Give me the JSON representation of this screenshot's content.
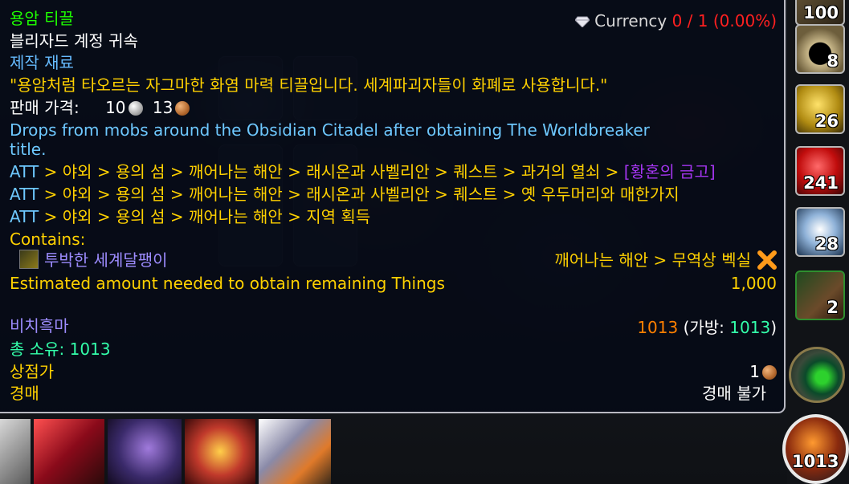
{
  "item": {
    "name": "용암 티끌",
    "binding": "블리자드 계정 귀속",
    "category": "제작 재료",
    "flavor": "\"용암처럼 타오르는 자그마한 화염 마력 티끌입니다. 세계파괴자들이 화폐로 사용합니다.\"",
    "sell_label": "판매 가격:",
    "sell_silver": "10",
    "sell_copper": "13"
  },
  "currency": {
    "label": "Currency",
    "progress": "0 / 1 (0.00%)",
    "progress_fraction": 0
  },
  "source": {
    "description_line1": "Drops from mobs around the Obsidian Citadel after obtaining The Worldbreaker",
    "description_line2": "title."
  },
  "paths": [
    {
      "prefix": "ATT",
      "path": " > 야외 > 용의 섬 > 깨어나는 해안 > 래시온과 사벨리안 > 퀘스트 > 과거의 열쇠 > ",
      "highlight": "[황혼의 금고]"
    },
    {
      "prefix": "ATT",
      "path": " > 야외 > 용의 섬 > 깨어나는 해안 > 래시온과 사벨리안 > 퀘스트 > 옛 우두머리와 매한가지",
      "highlight": ""
    },
    {
      "prefix": "ATT",
      "path": " > 야외 > 용의 섬 > 깨어나는 해안 > 지역 획득",
      "highlight": ""
    }
  ],
  "contains": {
    "label": "Contains:",
    "item_name": "투박한 세계달팽이",
    "item_location": "깨어나는 해안 > 무역상 벡실"
  },
  "estimate": {
    "label": "Estimated amount needed to obtain remaining Things",
    "value": "1,000"
  },
  "owners": {
    "character": "비치흑마",
    "count": "1013",
    "bag_label": "(가방: ",
    "bag_count": "1013",
    "bag_close": ")",
    "total_label": "총 소유: ",
    "total": "1013"
  },
  "vendor": {
    "label": "상점가",
    "price": "1"
  },
  "auction": {
    "label": "경매",
    "value": "경매 불가"
  },
  "right_bar": [
    {
      "icon": "bag-icon",
      "count": "100"
    },
    {
      "icon": "maw-icon",
      "count": "8"
    },
    {
      "icon": "gold-ore-icon",
      "count": "26"
    },
    {
      "icon": "red-orb-icon",
      "count": "241"
    },
    {
      "icon": "spirit-icon",
      "count": "28"
    },
    {
      "icon": "claw-icon",
      "count": "2"
    },
    {
      "icon": "flame-mote-icon",
      "count": "1013"
    }
  ],
  "colors": {
    "yellow": "#ffd100",
    "green": "#1eff00",
    "blue_link": "#66bbff",
    "purple": "#a335ee",
    "orange": "#ff8000",
    "teal": "#33ffaa",
    "red": "#ff2020"
  }
}
